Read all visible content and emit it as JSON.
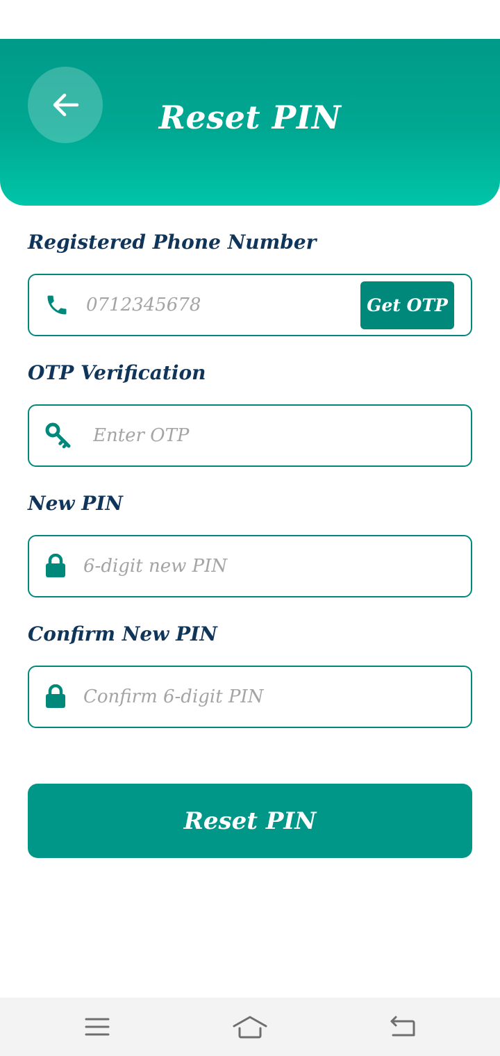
{
  "header": {
    "title": "Reset PIN"
  },
  "phone": {
    "label": "Registered Phone Number",
    "placeholder": "0712345678",
    "get_otp_label": "Get OTP"
  },
  "otp": {
    "label": "OTP Verification",
    "placeholder": "Enter OTP"
  },
  "new_pin": {
    "label": "New PIN",
    "placeholder": "6-digit new PIN"
  },
  "confirm_pin": {
    "label": "Confirm New PIN",
    "placeholder": "Confirm 6-digit PIN"
  },
  "submit": {
    "label": "Reset PIN"
  },
  "icons": {
    "back": "arrow-left-icon",
    "phone": "phone-icon",
    "otp": "key-icon",
    "pin": "lock-icon",
    "nav_menu": "menu-icon",
    "nav_home": "home-icon",
    "nav_back": "return-icon"
  },
  "colors": {
    "primary": "#009688",
    "header_top": "#009a89",
    "header_bottom": "#00c5a8",
    "label_text": "#10355a",
    "placeholder": "#a4a4a4"
  }
}
